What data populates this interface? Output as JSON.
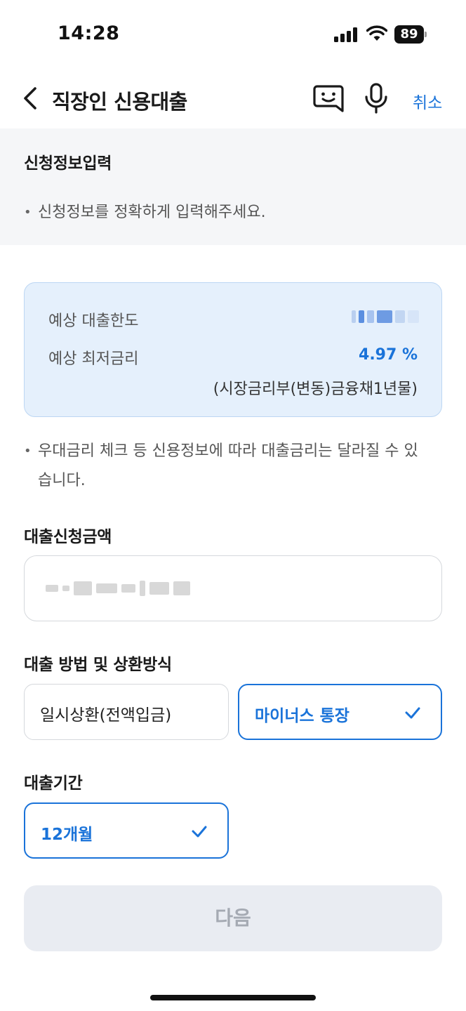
{
  "status_bar": {
    "time": "14:28",
    "battery": "89"
  },
  "nav": {
    "title": "직장인 신용대출",
    "cancel_label": "취소",
    "icons": [
      "back-icon",
      "chatbot-icon",
      "microphone-icon"
    ]
  },
  "info": {
    "heading": "신청정보입력",
    "bullet": "신청정보를 정확하게 입력해주세요."
  },
  "estimate": {
    "limit_label": "예상 대출한도",
    "rate_label": "예상 최저금리",
    "rate_value": "4.97 %",
    "rate_note": "(시장금리부(변동)금융채1년물)"
  },
  "notice": {
    "bullet_line1": "우대금리 체크 등 신용정보에 따라 대출금리는 달라질 수 있",
    "bullet_line2": "습니다."
  },
  "amount": {
    "heading": "대출신청금액"
  },
  "method": {
    "heading": "대출 방법 및 상환방식",
    "options": [
      {
        "label": "일시상환(전액입금)",
        "selected": false
      },
      {
        "label": "마이너스 통장",
        "selected": true
      }
    ]
  },
  "period": {
    "heading": "대출기간",
    "selected_label": "12개월"
  },
  "next_label": "다음",
  "colors": {
    "accent": "#1a73d9",
    "card_bg": "#e5f0fc",
    "panel_bg": "#f5f6f8",
    "disabled_bg": "#e9ecf2"
  }
}
